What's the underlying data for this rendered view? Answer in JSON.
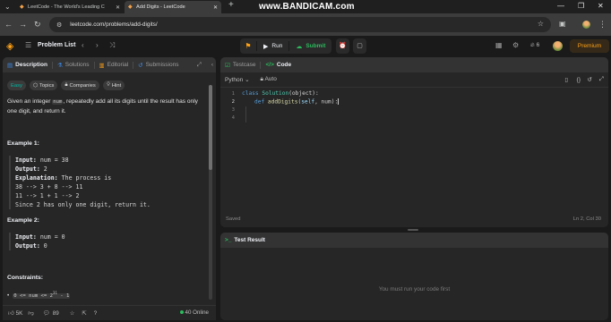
{
  "browser": {
    "tabs": [
      {
        "title": "LeetCode - The World's Leading C",
        "active": false
      },
      {
        "title": "Add Digits - LeetCode",
        "active": true
      }
    ],
    "new_tab": "+",
    "watermark": "www.BANDICAM.com",
    "url": "leetcode.com/problems/add-digits/"
  },
  "header": {
    "problem_list": "Problem List",
    "run": "Run",
    "submit": "Submit",
    "streak": "6",
    "premium": "Premium"
  },
  "left": {
    "tabs": [
      "Description",
      "Solutions",
      "Editorial",
      "Submissions"
    ],
    "chips": [
      "Easy",
      "Topics",
      "Companies",
      "Hint"
    ],
    "statement_pre": "Given an integer ",
    "statement_code": "num",
    "statement_post": ", repeatedly add all its digits until the result has only one digit, and return it.",
    "example1": {
      "title": "Example 1:",
      "input_label": "Input:",
      "input_value": "num = 38",
      "output_label": "Output:",
      "output_value": "2",
      "expl_label": "Explanation:",
      "expl_value": "The process is",
      "lines": [
        "38 --> 3 + 8 --> 11",
        "11 --> 1 + 1 --> 2",
        "Since 2 has only one digit, return it."
      ]
    },
    "example2": {
      "title": "Example 2:",
      "input_label": "Input:",
      "input_value": "num = 0",
      "output_label": "Output:",
      "output_value": "0"
    },
    "constraints_title": "Constraints:",
    "constraint_pre": "0 <= num <= 2",
    "constraint_sup": "31",
    "constraint_post": " - 1",
    "footer": {
      "likes": "5K",
      "comments": "89",
      "online": "40 Online"
    }
  },
  "code": {
    "tabs": [
      "Testcase",
      "Code"
    ],
    "language": "Python",
    "auto": "Auto",
    "line_numbers": [
      "1",
      "2",
      "3",
      "4"
    ],
    "line1": {
      "kw": "class",
      "name": "Solution",
      "rest": "(object):"
    },
    "line2": {
      "kw": "def",
      "name": "addDigits",
      "self": "self",
      "rest": ", num):"
    },
    "saved": "Saved",
    "cursor": "Ln 2, Col 30"
  },
  "result": {
    "title": "Test Result",
    "empty": "You must run your code first"
  },
  "colors": {
    "accent": "#ffa116",
    "success": "#2cbb5d",
    "easy": "#00b8a3"
  }
}
